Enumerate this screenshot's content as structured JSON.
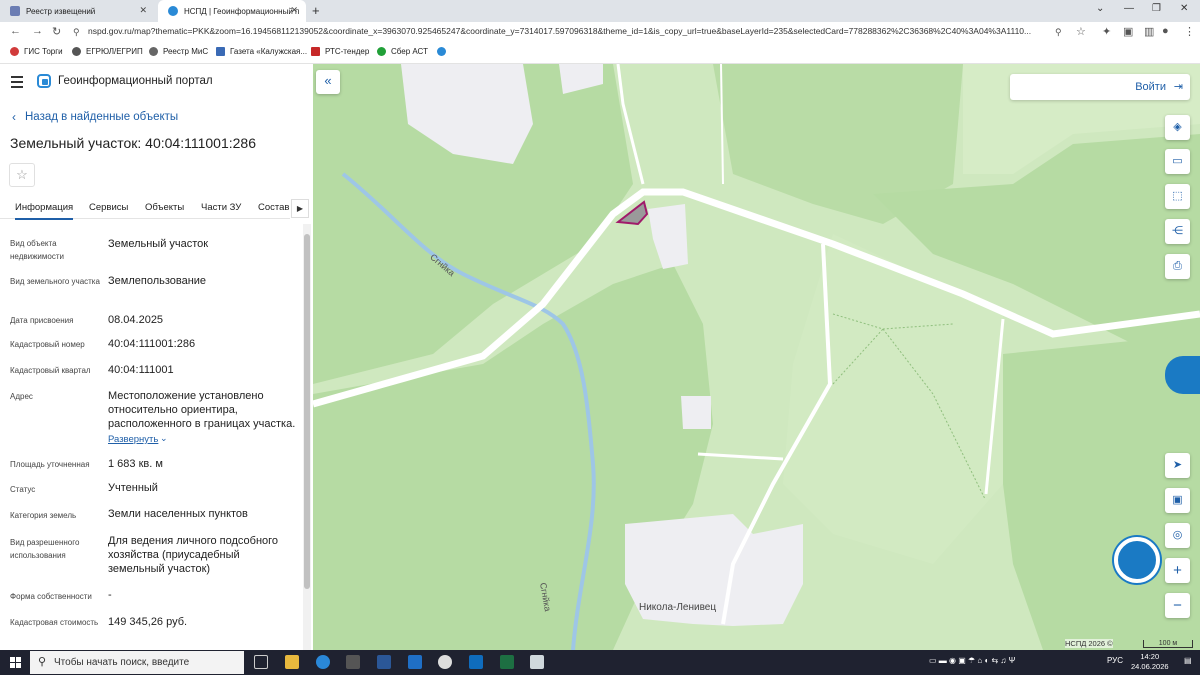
{
  "browser": {
    "tabs": [
      {
        "title": "Реестр извещений"
      },
      {
        "title": "НСПД | Геоинформационный п"
      }
    ],
    "url": "nspd.gov.ru/map?thematic=PKK&zoom=16.194568112139052&coordinate_x=3963070.925465247&coordinate_y=7314017.597096318&theme_id=1&is_copy_url=true&baseLayerId=235&selectedCard=778288362%2C36368%2C40%3A04%3A1110...",
    "bookmarks": [
      "ГИС Торги",
      "ЕГРЮЛ/ЕГРИП",
      "Реестр МиС",
      "Газета «Калужская...",
      "РТС-тендер",
      "Сбер АСТ"
    ]
  },
  "portal": {
    "name": "Геоинформационный портал",
    "back_label": "Назад в найденные объекты",
    "object_title": "Земельный участок: 40:04:111001:286",
    "tabs": [
      "Информация",
      "Сервисы",
      "Объекты",
      "Части ЗУ",
      "Состав"
    ],
    "rows": [
      {
        "label": "Вид объекта недвижимости",
        "value": "Земельный участок"
      },
      {
        "label": "Вид земельного участка",
        "value": "Землепользование"
      },
      {
        "label": "Дата присвоения",
        "value": "08.04.2025"
      },
      {
        "label": "Кадастровый номер",
        "value": "40:04:111001:286"
      },
      {
        "label": "Кадастровый квартал",
        "value": "40:04:111001"
      },
      {
        "label": "Адрес",
        "value": "Местоположение установлено относительно ориентира, расположенного в границах участка."
      },
      {
        "label": "Площадь уточненная",
        "value": "1 683 кв. м"
      },
      {
        "label": "Статус",
        "value": "Учтенный"
      },
      {
        "label": "Категория земель",
        "value": "Земли населенных пунктов"
      },
      {
        "label": "Вид разрешенного использования",
        "value": "Для ведения личного подсобного хозяйства (приусадебный земельный участок)"
      },
      {
        "label": "Форма собственности",
        "value": "-"
      },
      {
        "label": "Кадастровая стоимость",
        "value": "149 345,26 руб."
      }
    ],
    "expand_label": "Развернуть"
  },
  "map": {
    "login_label": "Войти",
    "labels": {
      "river1": "Сгнйка",
      "river2": "Сгнйка",
      "village": "Никола-Ленивец"
    },
    "attribution": "НСПД 2026 ©",
    "scale": "100 м"
  },
  "taskbar": {
    "search_placeholder": "Чтобы начать поиск, введите",
    "lang": "РУС",
    "time": "14:20",
    "date": "24.06.2026"
  },
  "colors": {
    "accent": "#1f5fa8",
    "forest": "#b6dba3",
    "meadow": "#cfe8bf",
    "river": "#9ec6e6",
    "parcel": "#a01a6a"
  }
}
